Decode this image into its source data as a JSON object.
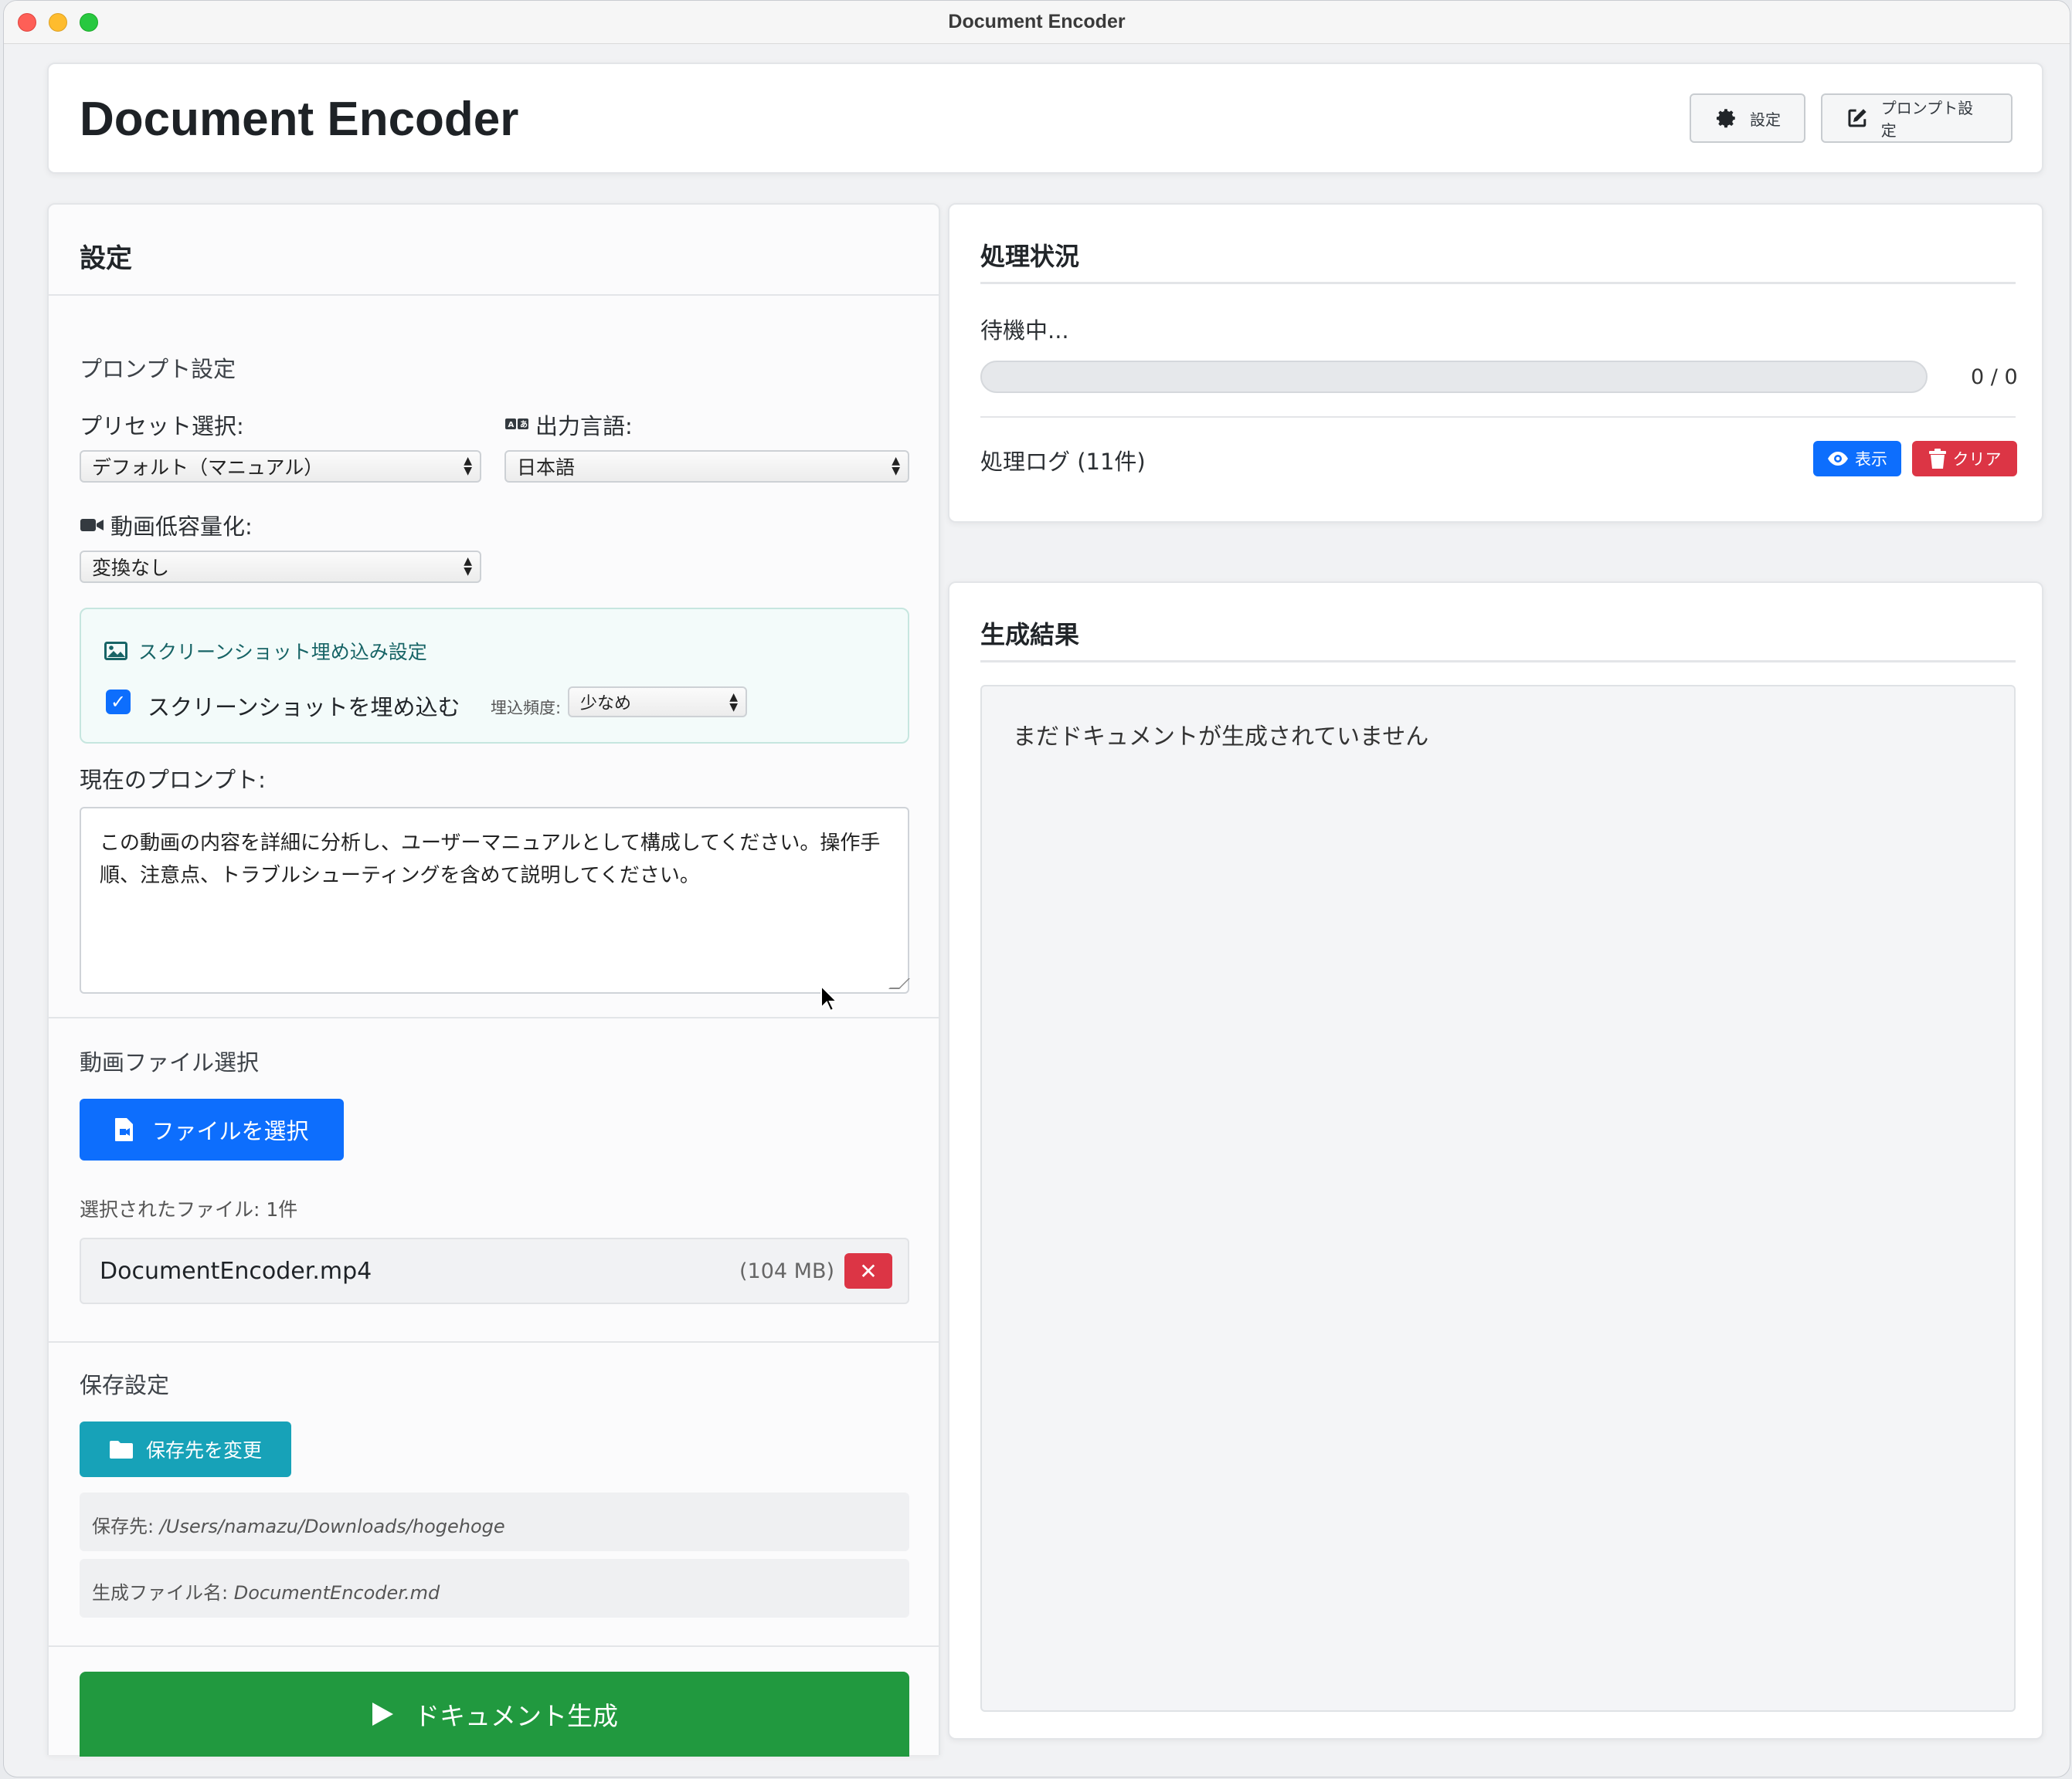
{
  "window": {
    "title": "Document Encoder"
  },
  "header": {
    "app_title": "Document Encoder",
    "settings_label": "設定",
    "prompt_settings_label": "プロンプト設定"
  },
  "settings_panel": {
    "title": "設定",
    "prompt_section": "プロンプト設定",
    "preset_label": "プリセット選択:",
    "preset_value": "デフォルト（マニュアル）",
    "language_label": "出力言語:",
    "language_value": "日本語",
    "video_compress_label": "動画低容量化:",
    "video_compress_value": "変換なし",
    "screenshot": {
      "title": "スクリーンショット埋め込み設定",
      "checkbox_label": "スクリーンショットを埋め込む",
      "checked": true,
      "frequency_label": "埋込頻度:",
      "frequency_value": "少なめ"
    },
    "current_prompt_label": "現在のプロンプト:",
    "current_prompt": "この動画の内容を詳細に分析し、ユーザーマニュアルとして構成してください。操作手順、注意点、トラブルシューティングを含めて説明してください。",
    "file_section": "動画ファイル選択",
    "file_button": "ファイルを選択",
    "selected_count": "選択されたファイル: 1件",
    "file": {
      "name": "DocumentEncoder.mp4",
      "size": "(104 MB)"
    },
    "save_section": "保存設定",
    "save_button": "保存先を変更",
    "save_path_key": "保存先: ",
    "save_path": "/Users/namazu/Downloads/hogehoge",
    "filename_key": "生成ファイル名: ",
    "filename": "DocumentEncoder.md",
    "generate_button": "ドキュメント生成"
  },
  "status_panel": {
    "title": "処理状況",
    "state": "待機中...",
    "progress": 0,
    "progress_count": "0 / 0",
    "log_label": "処理ログ (11件)",
    "show_button": "表示",
    "clear_button": "クリア"
  },
  "result_panel": {
    "title": "生成結果",
    "empty_message": "まだドキュメントが生成されていません"
  },
  "colors": {
    "primary": "#0d6efd",
    "danger": "#dc3545",
    "info": "#17a2b8",
    "success": "#21993f"
  }
}
